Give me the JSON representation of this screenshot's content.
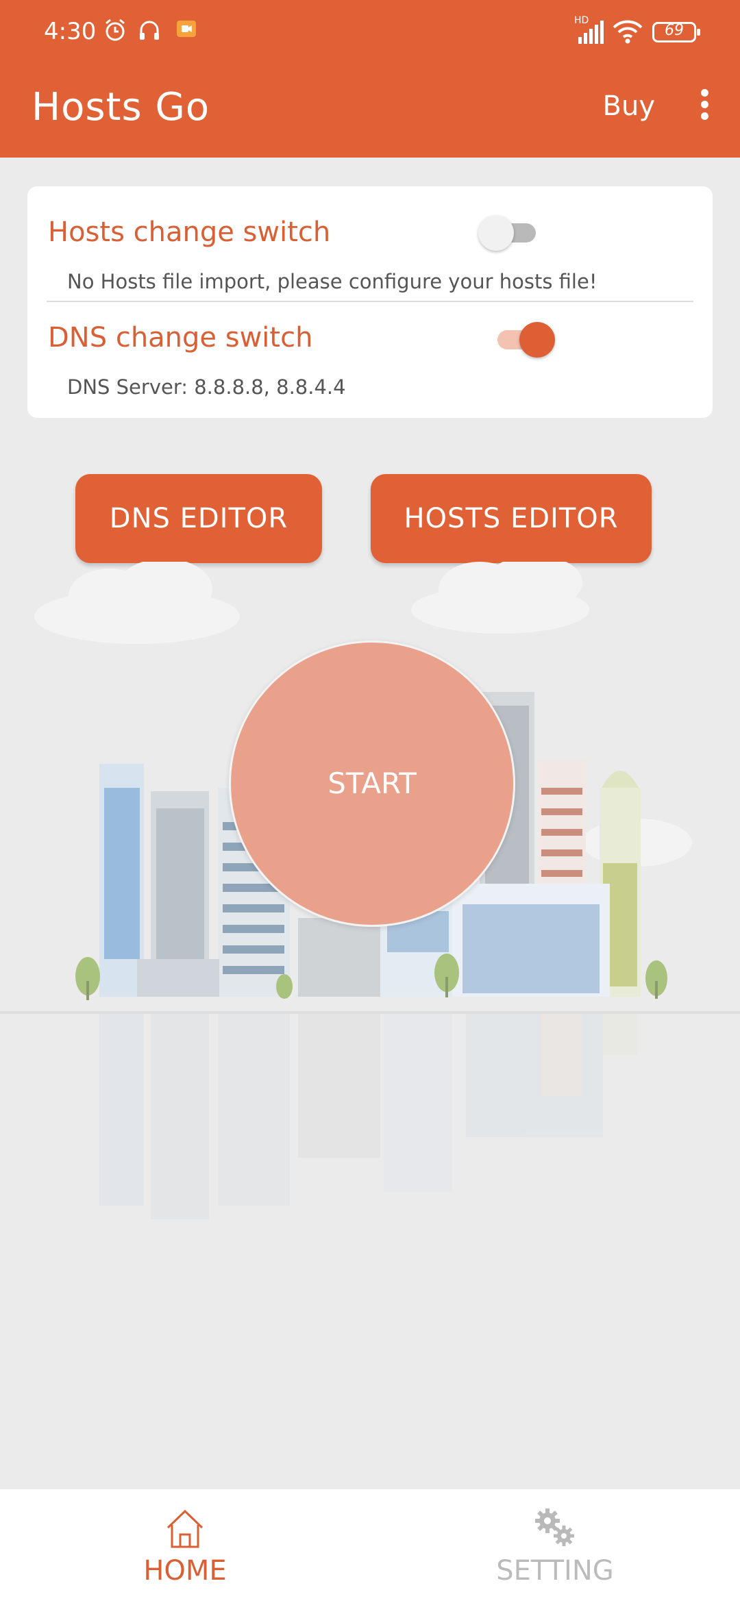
{
  "status_bar": {
    "time": "4:30",
    "battery": "69",
    "network_badge": "HD"
  },
  "app_bar": {
    "title": "Hosts Go",
    "buy_label": "Buy"
  },
  "hosts_switch": {
    "title": "Hosts change switch",
    "subtitle": "No Hosts file import, please configure your hosts file!",
    "enabled": false
  },
  "dns_switch": {
    "title": "DNS change switch",
    "subtitle": "DNS Server:  8.8.8.8,  8.8.4.4",
    "enabled": true
  },
  "buttons": {
    "dns_editor": "DNS EDITOR",
    "hosts_editor": "HOSTS EDITOR",
    "start": "START"
  },
  "bottom_nav": {
    "home": "HOME",
    "setting": "SETTING"
  },
  "colors": {
    "primary": "#e06136",
    "accent_light": "#e9a18b",
    "nav_inactive": "#bbbbbb"
  },
  "icons": {
    "status": [
      "alarm-icon",
      "headphones-icon",
      "record-icon",
      "signal-icon",
      "wifi-icon",
      "battery-icon"
    ],
    "nav": [
      "home-icon",
      "gears-icon"
    ]
  }
}
